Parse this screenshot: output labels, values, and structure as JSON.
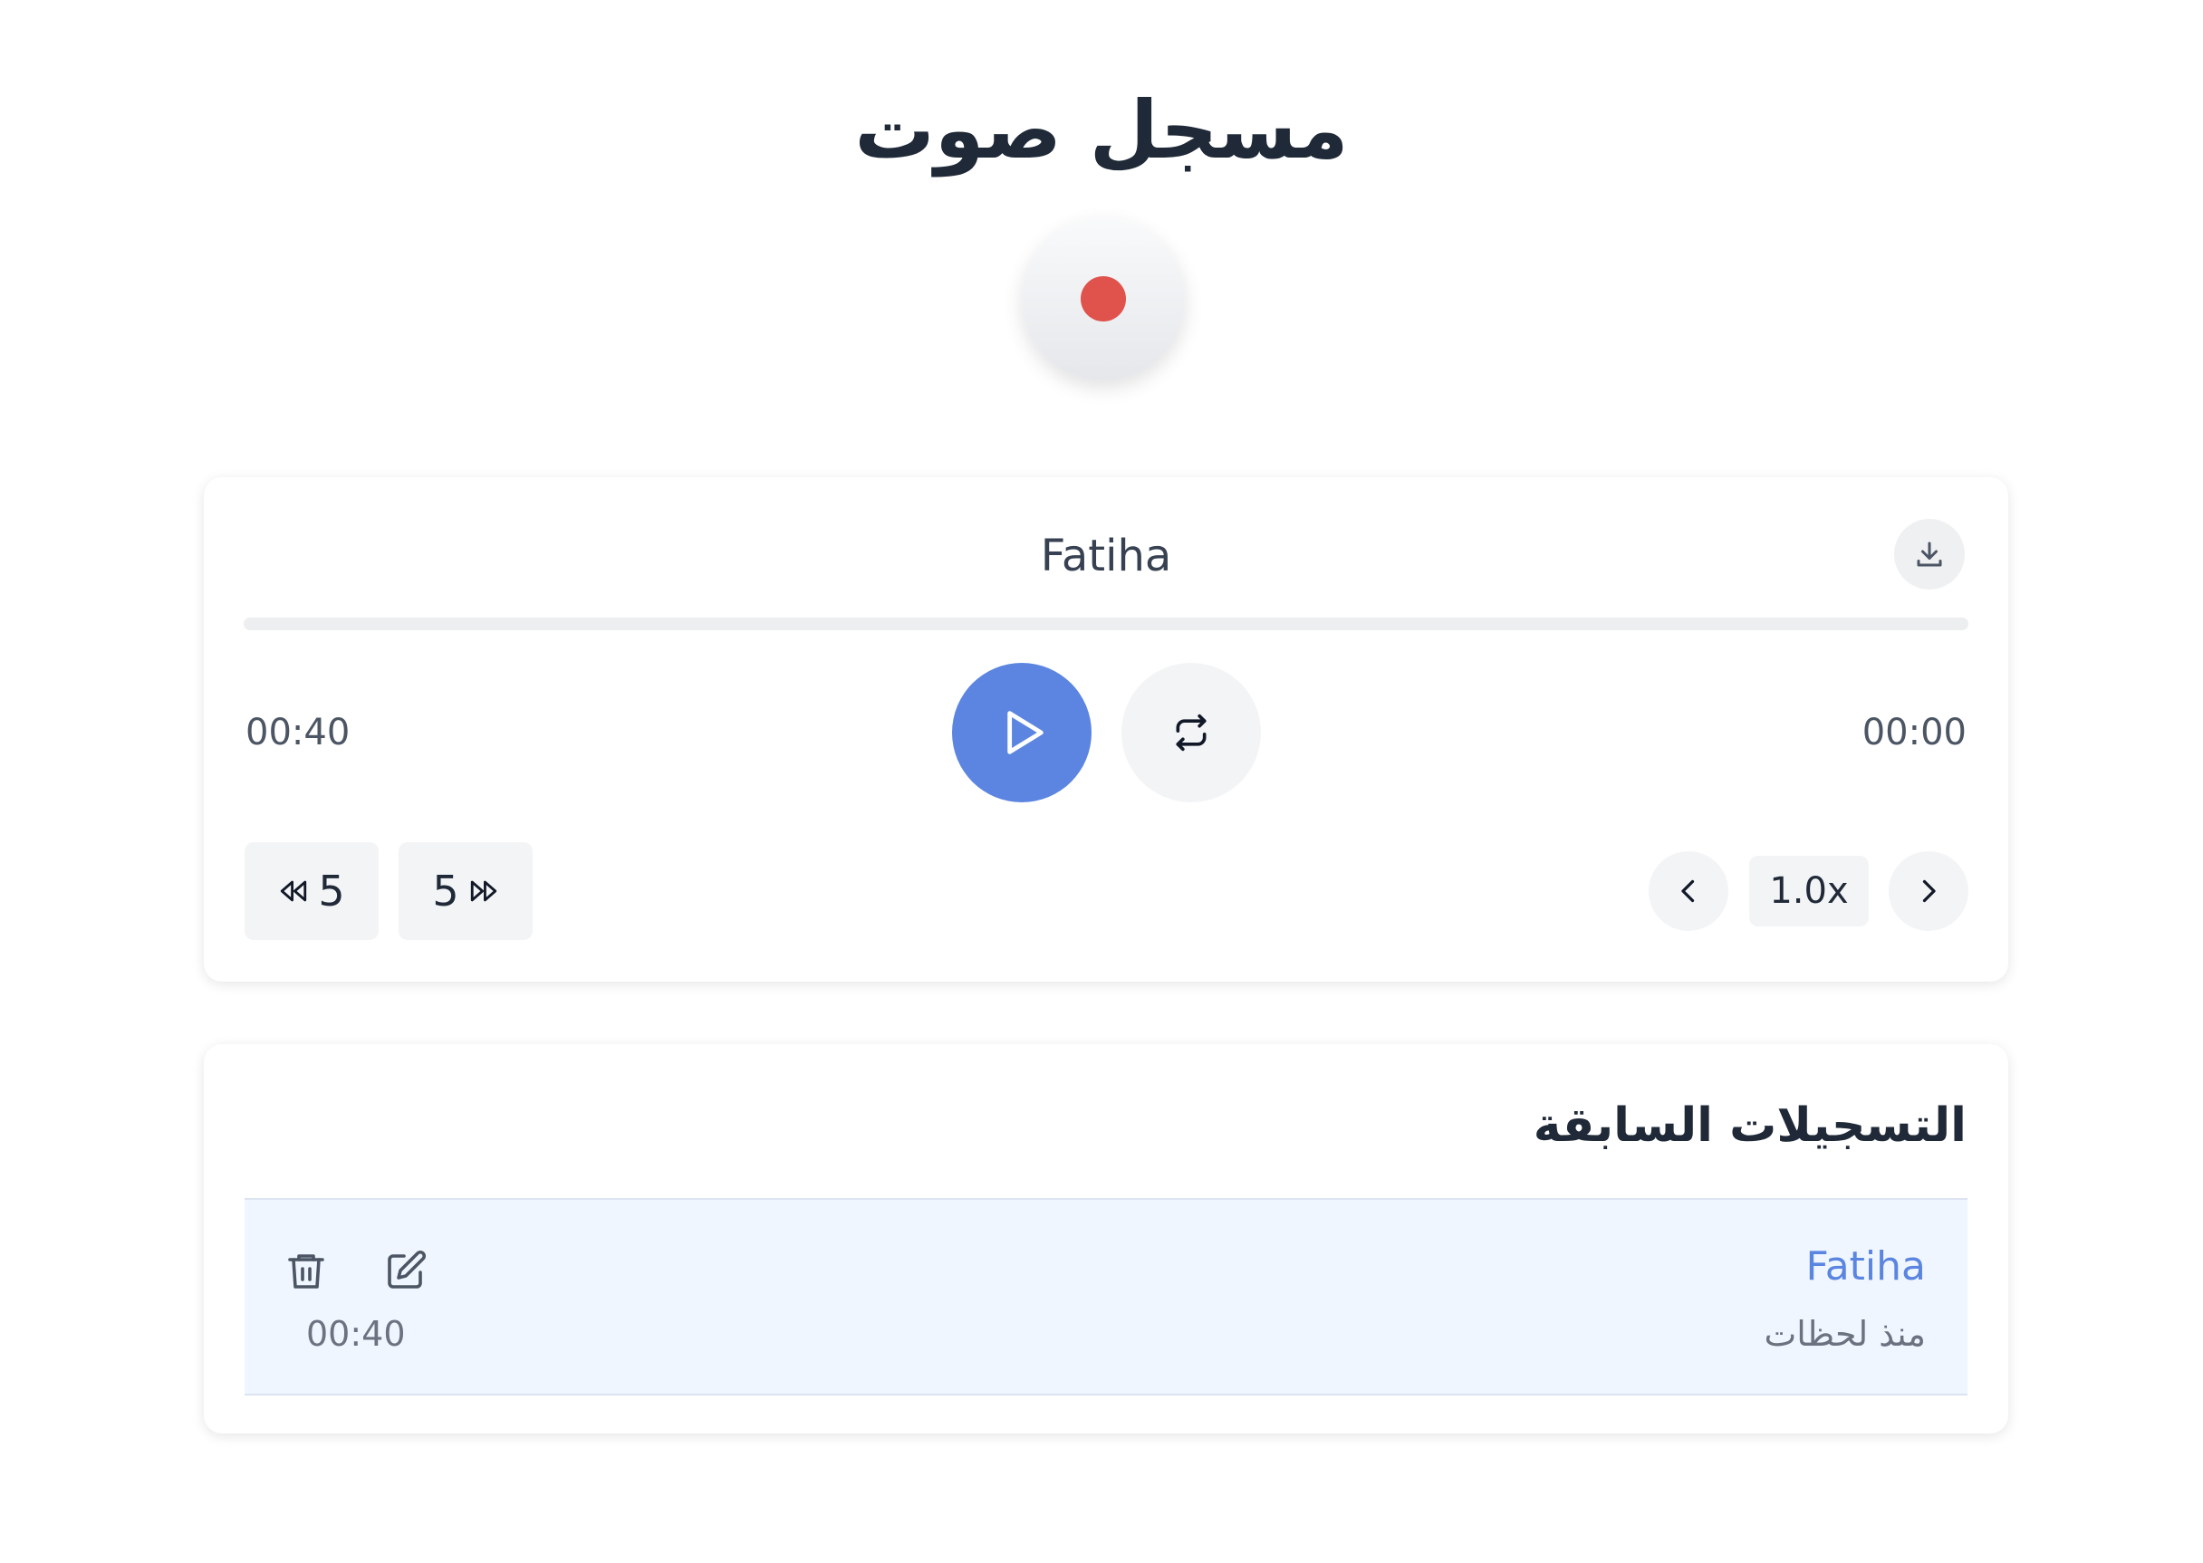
{
  "app": {
    "title": "مسجل صوت"
  },
  "recorder": {
    "record_icon": "record-dot-icon",
    "record_color": "#e0524c"
  },
  "player": {
    "track_name": "Fatiha",
    "current_time": "00:00",
    "duration": "00:40",
    "progress": 0,
    "skip_back_seconds": "5",
    "skip_forward_seconds": "5",
    "speed": "1.0x",
    "accent": "#5b85e0",
    "icons": [
      "download-icon",
      "play-icon",
      "repeat-icon",
      "rewind-icon",
      "fast-forward-icon",
      "chevron-left-icon",
      "chevron-right-icon"
    ]
  },
  "history": {
    "title": "التسجيلات السابقة",
    "items": [
      {
        "name": "Fatiha",
        "when": "منذ لحظات",
        "duration": "00:40"
      }
    ]
  }
}
